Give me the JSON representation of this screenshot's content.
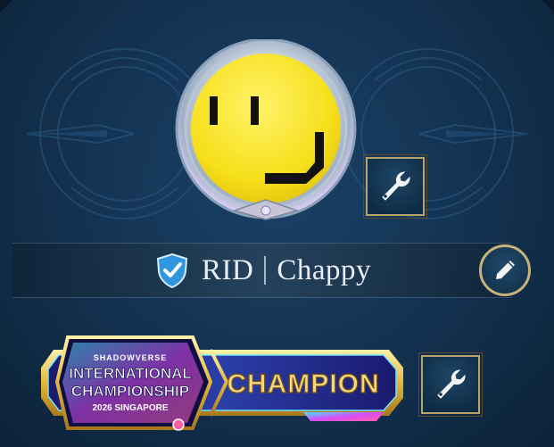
{
  "profile": {
    "rid_label": "RID",
    "player_name": "Chappy"
  },
  "title_badge": {
    "top_text": "SHADOWVERSE",
    "line1": "INTERNATIONAL",
    "line2": "CHAMPIONSHIP",
    "event": "2026 SINGAPORE",
    "rank": "CHAMPION"
  },
  "icons": {
    "avatar_edit": "wrench-icon",
    "name_edit": "pencil-icon",
    "title_edit": "wrench-icon",
    "verified": "shield-check-icon"
  },
  "colors": {
    "background": "#143454",
    "gold_frame": "#c7b27a",
    "shield_blue": "#2f97e0",
    "champion_text": "#f3d982"
  }
}
